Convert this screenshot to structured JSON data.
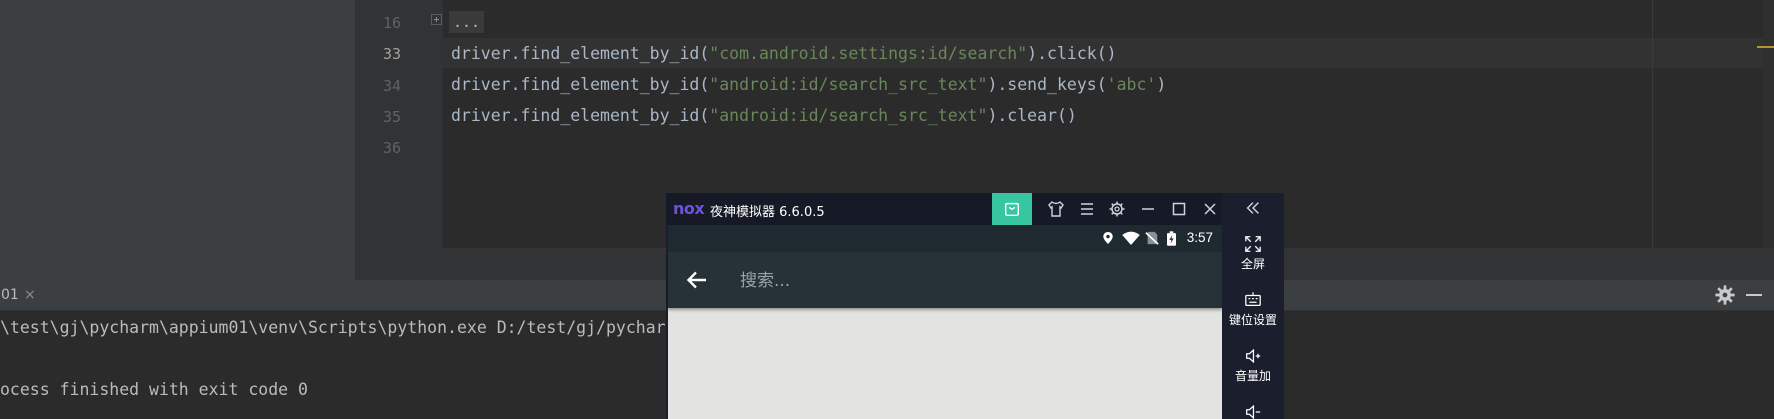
{
  "editor": {
    "lines": [
      {
        "number": "16",
        "folded_text": "..."
      },
      {
        "number": "33",
        "prefix": "driver.find_element_by_id(",
        "string": "\"com.android.settings:id/search\"",
        "suffix": ").click()"
      },
      {
        "number": "34",
        "prefix": "driver.find_element_by_id(",
        "string": "\"android:id/search_src_text\"",
        "suffix": ").send_keys(",
        "string2": "'abc'",
        "suffix2": ")"
      },
      {
        "number": "35",
        "prefix": "driver.find_element_by_id(",
        "string": "\"android:id/search_src_text\"",
        "suffix": ").clear()"
      },
      {
        "number": "36"
      }
    ]
  },
  "run_panel": {
    "tab_label": "01",
    "tab_close": "×",
    "console_lines": [
      "\\test\\gj\\pycharm\\appium01\\venv\\Scripts\\python.exe D:/test/gj/pycharm",
      "ocess finished with exit code 0"
    ]
  },
  "nox": {
    "logo": "nox",
    "title": "夜神模拟器 6.6.0.5",
    "status_time": "3:57",
    "search_placeholder": "搜索...",
    "sidebar": [
      {
        "label": "全屏",
        "icon": "fullscreen-icon"
      },
      {
        "label": "键位设置",
        "icon": "keyboard-icon"
      },
      {
        "label": "音量加",
        "icon": "volume-up-icon"
      }
    ],
    "colors": {
      "accent": "#37c6a0",
      "toolbar": "#263238",
      "brand": "#6c54d8"
    }
  },
  "colors": {
    "code_text": "#a9b7c6",
    "code_string": "#6a8759",
    "editor_bg": "#2b2b2b"
  }
}
